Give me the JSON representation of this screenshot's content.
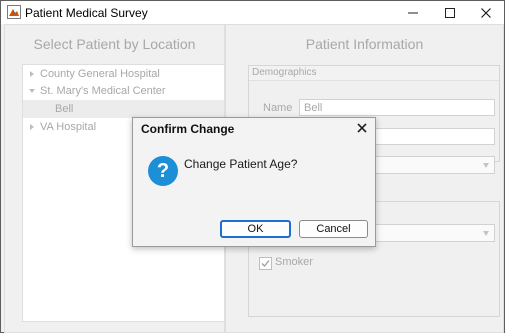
{
  "window": {
    "title": "Patient Medical Survey",
    "minimize_glyph": "—",
    "maximize_glyph": "☐",
    "close_glyph": "✕"
  },
  "left_panel": {
    "title": "Select Patient by Location",
    "tree": [
      {
        "label": "County General Hospital",
        "level": 0,
        "expanded": false,
        "selected": false
      },
      {
        "label": "St. Mary's Medical Center",
        "level": 0,
        "expanded": true,
        "selected": false
      },
      {
        "label": "Bell",
        "level": 1,
        "expanded": false,
        "selected": true
      },
      {
        "label": "VA Hospital",
        "level": 0,
        "expanded": false,
        "selected": false
      }
    ]
  },
  "right_panel": {
    "title": "Patient Information",
    "demographics": {
      "title": "Demographics",
      "name_label": "Name",
      "name_value": "Bell",
      "age_value": "",
      "gender_value": ""
    },
    "history": {
      "condition_value": "",
      "smoker_label": "Smoker",
      "smoker_checked": true
    }
  },
  "dialog": {
    "title": "Confirm Change",
    "message": "Change Patient Age?",
    "ok_label": "OK",
    "cancel_label": "Cancel",
    "icon": "question-icon",
    "icon_glyph": "?"
  },
  "colors": {
    "accent": "#1b6fd4",
    "question_icon": "#1d8fd6",
    "disabled_text": "#a8a8a8"
  }
}
